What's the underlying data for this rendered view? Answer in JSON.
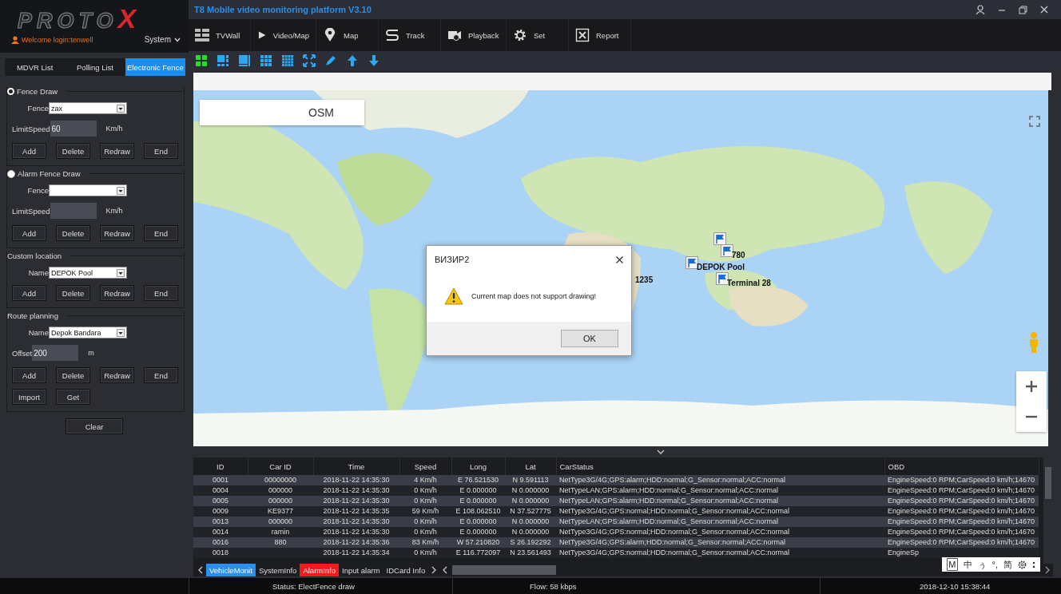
{
  "logo": {
    "text": "PROTO",
    "mark": "X"
  },
  "user": {
    "welcome": "Welcome login:tenwell",
    "menu": "System"
  },
  "side_tabs": [
    {
      "label": "MDVR List",
      "selected": false
    },
    {
      "label": "Polling List",
      "selected": false
    },
    {
      "label": "Electronic Fence",
      "selected": true
    }
  ],
  "sections": [
    {
      "kind": "radio",
      "legend": "Fence Draw",
      "selected": true,
      "fields": [
        {
          "kind": "select",
          "label": "Fence",
          "value": "zax"
        },
        {
          "kind": "input",
          "label": "LimitSpeed",
          "value": "60",
          "unit": "Km/h"
        }
      ],
      "buttons": [
        "Add",
        "Delete",
        "Redraw",
        "End"
      ]
    },
    {
      "kind": "radio",
      "legend": "Alarm Fence Draw",
      "selected": false,
      "fields": [
        {
          "kind": "select",
          "label": "Fence"
        },
        {
          "kind": "input",
          "label": "LimitSpeed",
          "unit": "Km/h"
        }
      ],
      "buttons": [
        "Add",
        "Delete",
        "Redraw",
        "End"
      ]
    },
    {
      "kind": "plain",
      "legend": "Custom location",
      "fields": [
        {
          "kind": "select",
          "label": "Name",
          "value": "DEPOK Pool"
        }
      ],
      "buttons": [
        "Add",
        "Delete",
        "Redraw",
        "End"
      ]
    },
    {
      "kind": "plain",
      "legend": "Route planning",
      "fields": [
        {
          "kind": "select",
          "label": "Name",
          "value": "Depok Bandara"
        },
        {
          "kind": "input",
          "label": "Offset",
          "value": "200",
          "unit": "m"
        }
      ],
      "buttons": [
        "Add",
        "Delete",
        "Redraw",
        "End",
        "Import",
        "Get"
      ]
    }
  ],
  "clear_button": "Clear",
  "window": {
    "title": "T8 Mobile video monitoring platform V3.10"
  },
  "nav": [
    {
      "kind": "tvwall",
      "label": "TVWall"
    },
    {
      "kind": "play",
      "label": "Video/Map"
    },
    {
      "kind": "pin",
      "label": "Map"
    },
    {
      "kind": "track",
      "label": "Track"
    },
    {
      "kind": "playback",
      "label": "Playback"
    },
    {
      "kind": "gear",
      "label": "Set"
    },
    {
      "kind": "report",
      "label": "Report"
    }
  ],
  "view_tools": [
    {
      "kind": "grid4",
      "selected": true
    },
    {
      "kind": "layout6",
      "selected": false
    },
    {
      "kind": "layout8",
      "selected": false
    },
    {
      "kind": "grid9",
      "selected": false
    },
    {
      "kind": "grid16",
      "selected": false
    },
    {
      "kind": "fullscreen",
      "selected": false
    },
    {
      "kind": "pen",
      "selected": false
    },
    {
      "kind": "up",
      "selected": false
    },
    {
      "kind": "down",
      "selected": false
    }
  ],
  "map": {
    "kind": "picture",
    "provider": "OSM",
    "markers": [
      {
        "flag": true
      },
      {
        "flag": true,
        "label": "780"
      },
      {
        "flag": true,
        "label": "DEPOK Pool"
      },
      {
        "flag": true,
        "label": "Terminal 28"
      },
      {
        "flag": false,
        "label": "1235"
      }
    ]
  },
  "dialog": {
    "title": "ВИЗИР2",
    "message": "Current map does not support drawing!",
    "button": "OK"
  },
  "table": {
    "columns": [
      "ID",
      "Car ID",
      "Time",
      "Speed",
      "Long",
      "Lat",
      "CarStatus",
      "OBD"
    ],
    "rows": [
      [
        "0001",
        "00000000",
        "2018-11-22 14:35:30",
        "4 Km/h",
        "E 76.521530",
        "N 9.591113",
        "NetType3G/4G;GPS:alarm;HDD:normal;G_Sensor:normal;ACC:normal",
        "EngineSpeed:0 RPM;CarSpeed:0 km/h;14670"
      ],
      [
        "0004",
        "000000",
        "2018-11-22 14:35:30",
        "0 Km/h",
        "E 0.000000",
        "N 0.000000",
        "NetTypeLAN;GPS:alarm;HDD:normal;G_Sensor:normal;ACC:normal",
        "EngineSpeed:0 RPM;CarSpeed:0 km/h;14670"
      ],
      [
        "0005",
        "000000",
        "2018-11-22 14:35:30",
        "0 Km/h",
        "E 0.000000",
        "N 0.000000",
        "NetTypeLAN;GPS:alarm;HDD:normal;G_Sensor:normal;ACC:normal",
        "EngineSpeed:0 RPM;CarSpeed:0 km/h;14670"
      ],
      [
        "0009",
        "KE9377",
        "2018-11-22 14:35:35",
        "59 Km/h",
        "E 108.062510",
        "N 37.527775",
        "NetType3G/4G;GPS:normal;HDD:normal;G_Sensor:normal;ACC:normal",
        "EngineSpeed:0 RPM;CarSpeed:0 km/h;14670"
      ],
      [
        "0013",
        "000000",
        "2018-11-22 14:35:30",
        "0 Km/h",
        "E 0.000000",
        "N 0.000000",
        "NetTypeLAN;GPS:alarm;HDD:normal;G_Sensor:normal;ACC:normal",
        "EngineSpeed:0 RPM;CarSpeed:0 km/h;14670"
      ],
      [
        "0014",
        "ramin",
        "2018-11-22 14:35:30",
        "0 Km/h",
        "E 0.000000",
        "N 0.000000",
        "NetType3G/4G;GPS:normal;HDD:normal;G_Sensor:normal;ACC:normal",
        "EngineSpeed:0 RPM;CarSpeed:0 km/h;14670"
      ],
      [
        "0016",
        "880",
        "2018-11-22 14:35:36",
        "83 Km/h",
        "W 57.210820",
        "S 26.192292",
        "NetType3G/4G;GPS:alarm;HDD:normal;G_Sensor:normal;ACC:normal",
        "EngineSpeed:0 RPM;CarSpeed:0 km/h;14670"
      ],
      [
        "0018",
        "",
        "2018-11-22 14:35:34",
        "0 Km/h",
        "E 116.772097",
        "N 23.561493",
        "NetType3G/4G;GPS:normal;HDD:normal;G_Sensor:normal;ACC:normal",
        "EngineSp"
      ]
    ]
  },
  "bottom_tabs": [
    {
      "label": "VehicleMonit",
      "selected": true,
      "alert": false
    },
    {
      "label": "SystemInfo",
      "selected": false,
      "alert": false
    },
    {
      "label": "AlarmInfo",
      "selected": false,
      "alert": true
    },
    {
      "label": "Input alarm",
      "selected": false,
      "alert": false
    },
    {
      "label": "IDCard Info",
      "selected": false,
      "alert": false
    }
  ],
  "ime_bar": [
    "M",
    "中",
    "ぅ",
    "°,",
    "简"
  ],
  "status_bar": {
    "status": "Status: ElectFence draw",
    "flow": "Flow: 58 kbps",
    "time": "2018-12-10 15:38:44"
  }
}
